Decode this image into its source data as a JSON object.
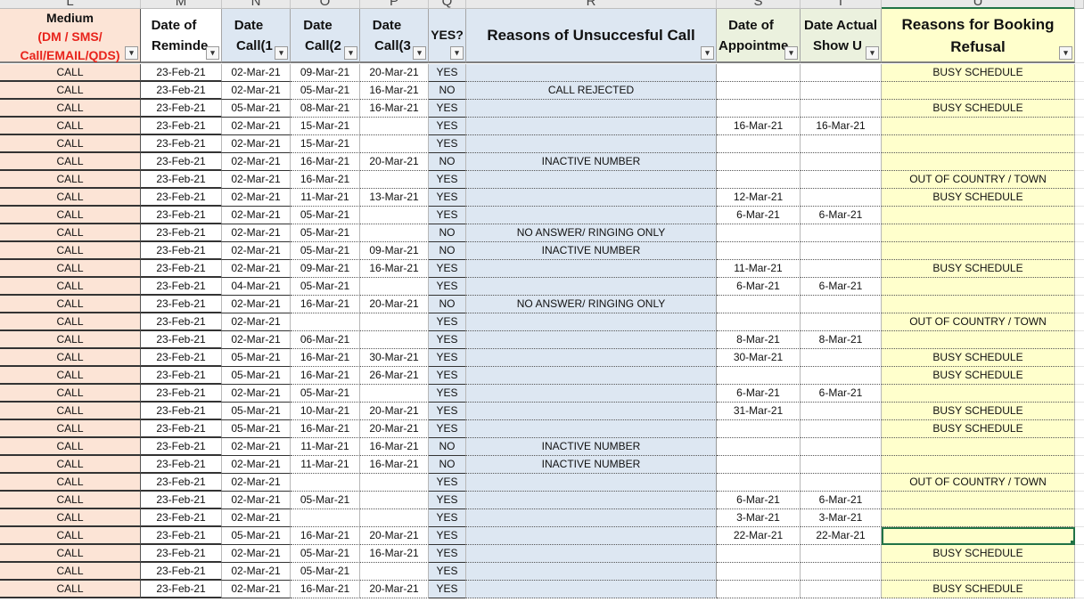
{
  "column_letters": [
    "L",
    "M",
    "N",
    "O",
    "P",
    "Q",
    "R",
    "S",
    "T",
    "U"
  ],
  "headers": {
    "medium_title": "Medium",
    "medium_sub1": "(DM / SMS/",
    "medium_sub2": "Call/EMAIL/QDS)",
    "date_reminder_1": "Date of",
    "date_reminder_2": "Reminde",
    "date_call1_1": "Date",
    "date_call1_2": "Call(1",
    "date_call2_1": "Date",
    "date_call2_2": "Call(2",
    "date_call3_1": "Date",
    "date_call3_2": "Call(3",
    "yes": "YES?",
    "reasons_unsuccessful": "Reasons of Unsuccesful Call",
    "date_appointment_1": "Date of",
    "date_appointment_2": "Appointme",
    "date_show_1": "Date Actual",
    "date_show_2": "Show U",
    "reasons_refusal_1": "Reasons for Booking",
    "reasons_refusal_2": "Refusal"
  },
  "filter_glyph": "▾",
  "colors": {
    "medium_red": "#e8231b",
    "medium_fill": "#fce4d6",
    "blue_fill": "#dde7f2",
    "yellow_fill": "#ffffcc",
    "green_fill": "#ebf1de",
    "selection": "#217346"
  },
  "rows": [
    {
      "medium": "CALL",
      "reminder": "23-Feb-21",
      "call1": "02-Mar-21",
      "call2": "09-Mar-21",
      "call3": "20-Mar-21",
      "yes": "YES",
      "reason": "",
      "appointment": "",
      "show": "",
      "refusal": "BUSY SCHEDULE"
    },
    {
      "medium": "CALL",
      "reminder": "23-Feb-21",
      "call1": "02-Mar-21",
      "call2": "05-Mar-21",
      "call3": "16-Mar-21",
      "yes": "NO",
      "reason": "CALL REJECTED",
      "appointment": "",
      "show": "",
      "refusal": ""
    },
    {
      "medium": "CALL",
      "reminder": "23-Feb-21",
      "call1": "05-Mar-21",
      "call2": "08-Mar-21",
      "call3": "16-Mar-21",
      "yes": "YES",
      "reason": "",
      "appointment": "",
      "show": "",
      "refusal": "BUSY SCHEDULE"
    },
    {
      "medium": "CALL",
      "reminder": "23-Feb-21",
      "call1": "02-Mar-21",
      "call2": "15-Mar-21",
      "call3": "",
      "yes": "YES",
      "reason": "",
      "appointment": "16-Mar-21",
      "show": "16-Mar-21",
      "refusal": ""
    },
    {
      "medium": "CALL",
      "reminder": "23-Feb-21",
      "call1": "02-Mar-21",
      "call2": "15-Mar-21",
      "call3": "",
      "yes": "YES",
      "reason": "",
      "appointment": "",
      "show": "",
      "refusal": ""
    },
    {
      "medium": "CALL",
      "reminder": "23-Feb-21",
      "call1": "02-Mar-21",
      "call2": "16-Mar-21",
      "call3": "20-Mar-21",
      "yes": "NO",
      "reason": "INACTIVE NUMBER",
      "appointment": "",
      "show": "",
      "refusal": ""
    },
    {
      "medium": "CALL",
      "reminder": "23-Feb-21",
      "call1": "02-Mar-21",
      "call2": "16-Mar-21",
      "call3": "",
      "yes": "YES",
      "reason": "",
      "appointment": "",
      "show": "",
      "refusal": "OUT OF COUNTRY / TOWN"
    },
    {
      "medium": "CALL",
      "reminder": "23-Feb-21",
      "call1": "02-Mar-21",
      "call2": "11-Mar-21",
      "call3": "13-Mar-21",
      "yes": "YES",
      "reason": "",
      "appointment": "12-Mar-21",
      "show": "",
      "refusal": "BUSY SCHEDULE"
    },
    {
      "medium": "CALL",
      "reminder": "23-Feb-21",
      "call1": "02-Mar-21",
      "call2": "05-Mar-21",
      "call3": "",
      "yes": "YES",
      "reason": "",
      "appointment": "6-Mar-21",
      "show": "6-Mar-21",
      "refusal": ""
    },
    {
      "medium": "CALL",
      "reminder": "23-Feb-21",
      "call1": "02-Mar-21",
      "call2": "05-Mar-21",
      "call3": "",
      "yes": "NO",
      "reason": "NO ANSWER/ RINGING ONLY",
      "appointment": "",
      "show": "",
      "refusal": ""
    },
    {
      "medium": "CALL",
      "reminder": "23-Feb-21",
      "call1": "02-Mar-21",
      "call2": "05-Mar-21",
      "call3": "09-Mar-21",
      "yes": "NO",
      "reason": "INACTIVE NUMBER",
      "appointment": "",
      "show": "",
      "refusal": ""
    },
    {
      "medium": "CALL",
      "reminder": "23-Feb-21",
      "call1": "02-Mar-21",
      "call2": "09-Mar-21",
      "call3": "16-Mar-21",
      "yes": "YES",
      "reason": "",
      "appointment": "11-Mar-21",
      "show": "",
      "refusal": "BUSY SCHEDULE"
    },
    {
      "medium": "CALL",
      "reminder": "23-Feb-21",
      "call1": "04-Mar-21",
      "call2": "05-Mar-21",
      "call3": "",
      "yes": "YES",
      "reason": "",
      "appointment": "6-Mar-21",
      "show": "6-Mar-21",
      "refusal": ""
    },
    {
      "medium": "CALL",
      "reminder": "23-Feb-21",
      "call1": "02-Mar-21",
      "call2": "16-Mar-21",
      "call3": "20-Mar-21",
      "yes": "NO",
      "reason": "NO ANSWER/ RINGING ONLY",
      "appointment": "",
      "show": "",
      "refusal": ""
    },
    {
      "medium": "CALL",
      "reminder": "23-Feb-21",
      "call1": "02-Mar-21",
      "call2": "",
      "call3": "",
      "yes": "YES",
      "reason": "",
      "appointment": "",
      "show": "",
      "refusal": "OUT OF COUNTRY / TOWN"
    },
    {
      "medium": "CALL",
      "reminder": "23-Feb-21",
      "call1": "02-Mar-21",
      "call2": "06-Mar-21",
      "call3": "",
      "yes": "YES",
      "reason": "",
      "appointment": "8-Mar-21",
      "show": "8-Mar-21",
      "refusal": ""
    },
    {
      "medium": "CALL",
      "reminder": "23-Feb-21",
      "call1": "05-Mar-21",
      "call2": "16-Mar-21",
      "call3": "30-Mar-21",
      "yes": "YES",
      "reason": "",
      "appointment": "30-Mar-21",
      "show": "",
      "refusal": "BUSY SCHEDULE"
    },
    {
      "medium": "CALL",
      "reminder": "23-Feb-21",
      "call1": "05-Mar-21",
      "call2": "16-Mar-21",
      "call3": "26-Mar-21",
      "yes": "YES",
      "reason": "",
      "appointment": "",
      "show": "",
      "refusal": "BUSY SCHEDULE"
    },
    {
      "medium": "CALL",
      "reminder": "23-Feb-21",
      "call1": "02-Mar-21",
      "call2": "05-Mar-21",
      "call3": "",
      "yes": "YES",
      "reason": "",
      "appointment": "6-Mar-21",
      "show": "6-Mar-21",
      "refusal": ""
    },
    {
      "medium": "CALL",
      "reminder": "23-Feb-21",
      "call1": "05-Mar-21",
      "call2": "10-Mar-21",
      "call3": "20-Mar-21",
      "yes": "YES",
      "reason": "",
      "appointment": "31-Mar-21",
      "show": "",
      "refusal": "BUSY SCHEDULE"
    },
    {
      "medium": "CALL",
      "reminder": "23-Feb-21",
      "call1": "05-Mar-21",
      "call2": "16-Mar-21",
      "call3": "20-Mar-21",
      "yes": "YES",
      "reason": "",
      "appointment": "",
      "show": "",
      "refusal": "BUSY SCHEDULE"
    },
    {
      "medium": "CALL",
      "reminder": "23-Feb-21",
      "call1": "02-Mar-21",
      "call2": "11-Mar-21",
      "call3": "16-Mar-21",
      "yes": "NO",
      "reason": "INACTIVE NUMBER",
      "appointment": "",
      "show": "",
      "refusal": ""
    },
    {
      "medium": "CALL",
      "reminder": "23-Feb-21",
      "call1": "02-Mar-21",
      "call2": "11-Mar-21",
      "call3": "16-Mar-21",
      "yes": "NO",
      "reason": "INACTIVE NUMBER",
      "appointment": "",
      "show": "",
      "refusal": ""
    },
    {
      "medium": "CALL",
      "reminder": "23-Feb-21",
      "call1": "02-Mar-21",
      "call2": "",
      "call3": "",
      "yes": "YES",
      "reason": "",
      "appointment": "",
      "show": "",
      "refusal": "OUT OF COUNTRY / TOWN"
    },
    {
      "medium": "CALL",
      "reminder": "23-Feb-21",
      "call1": "02-Mar-21",
      "call2": "05-Mar-21",
      "call3": "",
      "yes": "YES",
      "reason": "",
      "appointment": "6-Mar-21",
      "show": "6-Mar-21",
      "refusal": ""
    },
    {
      "medium": "CALL",
      "reminder": "23-Feb-21",
      "call1": "02-Mar-21",
      "call2": "",
      "call3": "",
      "yes": "YES",
      "reason": "",
      "appointment": "3-Mar-21",
      "show": "3-Mar-21",
      "refusal": ""
    },
    {
      "medium": "CALL",
      "reminder": "23-Feb-21",
      "call1": "05-Mar-21",
      "call2": "16-Mar-21",
      "call3": "20-Mar-21",
      "yes": "YES",
      "reason": "",
      "appointment": "22-Mar-21",
      "show": "22-Mar-21",
      "refusal": "",
      "selected": true
    },
    {
      "medium": "CALL",
      "reminder": "23-Feb-21",
      "call1": "02-Mar-21",
      "call2": "05-Mar-21",
      "call3": "16-Mar-21",
      "yes": "YES",
      "reason": "",
      "appointment": "",
      "show": "",
      "refusal": "BUSY SCHEDULE"
    },
    {
      "medium": "CALL",
      "reminder": "23-Feb-21",
      "call1": "02-Mar-21",
      "call2": "05-Mar-21",
      "call3": "",
      "yes": "YES",
      "reason": "",
      "appointment": "",
      "show": "",
      "refusal": ""
    },
    {
      "medium": "CALL",
      "reminder": "23-Feb-21",
      "call1": "02-Mar-21",
      "call2": "16-Mar-21",
      "call3": "20-Mar-21",
      "yes": "YES",
      "reason": "",
      "appointment": "",
      "show": "",
      "refusal": "BUSY SCHEDULE"
    }
  ]
}
